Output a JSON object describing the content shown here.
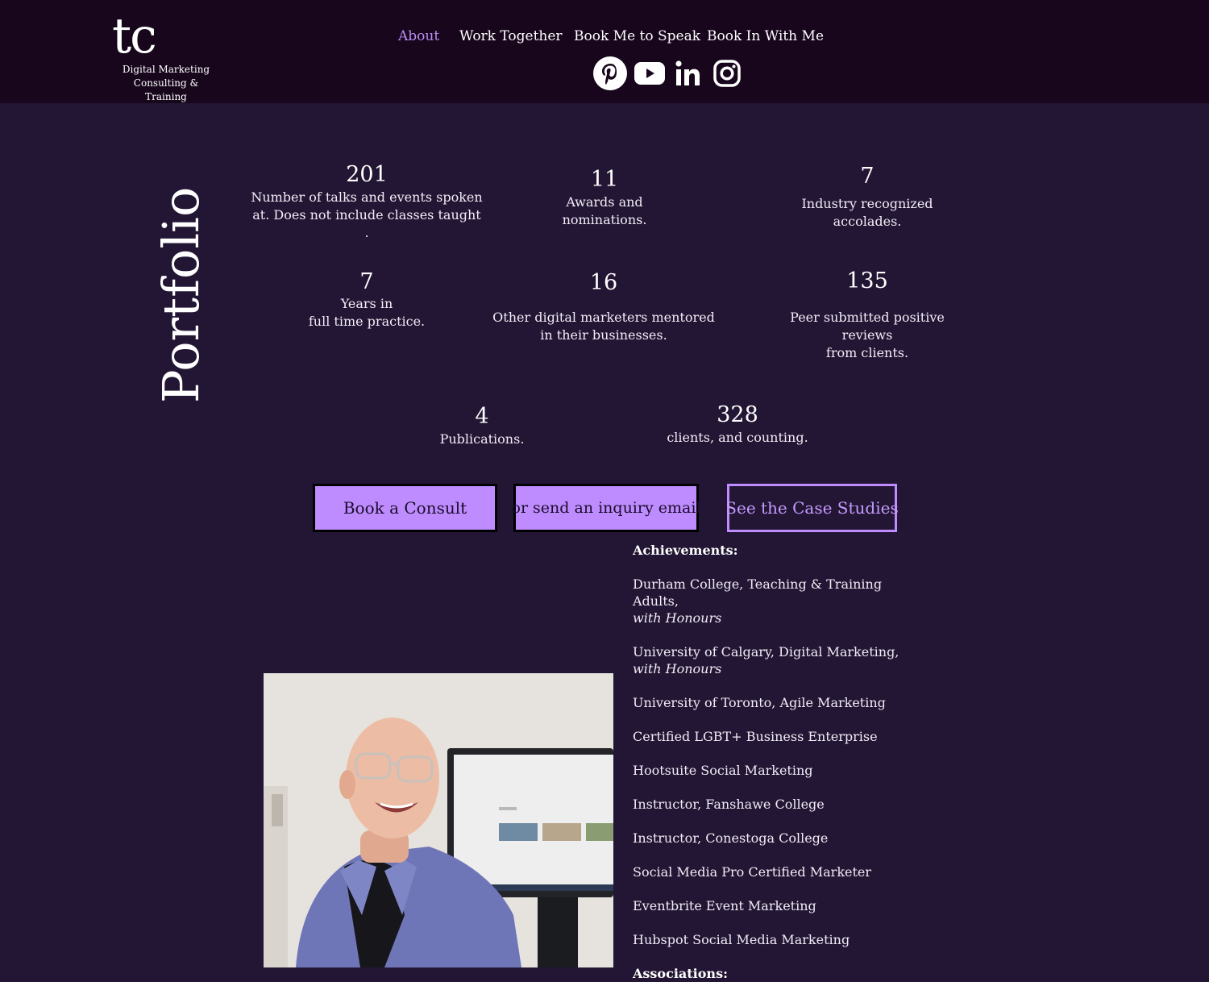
{
  "logo": {
    "mark": "tc",
    "line1": "Digital Marketing",
    "line2": "Consulting & Training"
  },
  "nav": {
    "items": [
      {
        "label": "About"
      },
      {
        "label": "Work Together"
      },
      {
        "label": "Book Me to Speak"
      },
      {
        "label": "Book In With Me"
      }
    ]
  },
  "socials": [
    "pinterest-icon",
    "youtube-icon",
    "linkedin-icon",
    "instagram-icon"
  ],
  "page_title": "Portfolio",
  "stats": [
    {
      "value": "201",
      "label1": "Number of talks and events spoken",
      "label2": "at. Does not include classes taught ."
    },
    {
      "value": "11",
      "label1": "Awards and",
      "label2": "nominations."
    },
    {
      "value": "7",
      "label1": "Industry recognized",
      "label2": "accolades."
    },
    {
      "value": "7",
      "label1": "Years in",
      "label2": "full time practice."
    },
    {
      "value": "16",
      "label1": "Other digital marketers mentored",
      "label2": "in their businesses."
    },
    {
      "value": "135",
      "label1": "Peer submitted positive",
      "label2": "reviews",
      "label3": "from clients."
    },
    {
      "value": "4",
      "label1": "Publications."
    },
    {
      "value": "328",
      "label1": "clients, and counting."
    }
  ],
  "buttons": {
    "consult": "Book a Consult",
    "inquiry": "or send an inquiry email",
    "case_studies": "See the Case Studies"
  },
  "achievements": {
    "heading": "Achievements:",
    "items": [
      {
        "text": "Durham College, Teaching & Training Adults,",
        "note": "with Honours"
      },
      {
        "text": "University of Calgary, Digital Marketing,",
        "note": "with Honours"
      },
      {
        "text": "University of Toronto, Agile Marketing"
      },
      {
        "text": "Certified LGBT+ Business Enterprise"
      },
      {
        "text": "Hootsuite Social Marketing"
      },
      {
        "text": "Instructor, Fanshawe College"
      },
      {
        "text": "Instructor, Conestoga College"
      },
      {
        "text": "Social Media Pro Certified Marketer"
      },
      {
        "text": "Eventbrite Event Marketing"
      },
      {
        "text": "Hubspot Social Media Marketing"
      }
    ],
    "associations_heading": "Associations:"
  },
  "colors": {
    "background": "#231634",
    "header": "#17061c",
    "accent": "#bf8cff",
    "nav_active": "#b98ef3"
  }
}
